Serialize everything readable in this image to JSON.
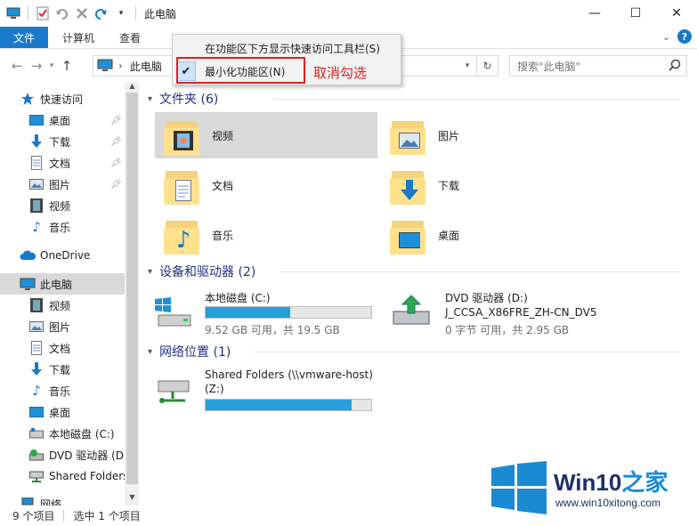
{
  "window": {
    "title": "此电脑",
    "minimize_glyph": "—",
    "maximize_glyph": "☐",
    "close_glyph": "✕"
  },
  "ribbon": {
    "tabs": [
      "文件",
      "计算机",
      "查看"
    ]
  },
  "menu": {
    "item1": "在功能区下方显示快速访问工具栏(S)",
    "item2": "最小化功能区(N)",
    "item2_checked": true
  },
  "annotation": {
    "text": "取消勾选",
    "color": "#e02020"
  },
  "address": {
    "crumb": "此电脑",
    "search_placeholder": "搜索\"此电脑\""
  },
  "nav": {
    "quick_access": "快速访问",
    "quick_items": [
      "桌面",
      "下载",
      "文档",
      "图片",
      "视频",
      "音乐"
    ],
    "onedrive": "OneDrive",
    "this_pc": "此电脑",
    "pc_items": [
      "视频",
      "图片",
      "文档",
      "下载",
      "音乐",
      "桌面",
      "本地磁盘 (C:)",
      "DVD 驱动器 (D:",
      "Shared Folders"
    ],
    "network": "网络"
  },
  "content": {
    "folders_header": "文件夹 (6)",
    "folders": [
      "视频",
      "图片",
      "文档",
      "下载",
      "音乐",
      "桌面"
    ],
    "devices_header": "设备和驱动器 (2)",
    "drive_c": {
      "name": "本地磁盘 (C:)",
      "info": "9.52 GB 可用，共 19.5 GB",
      "used_fraction": 0.51
    },
    "drive_d": {
      "name": "DVD 驱动器 (D:)",
      "label": "J_CCSA_X86FRE_ZH-CN_DV5",
      "info": "0 字节 可用，共 2.95 GB"
    },
    "network_header": "网络位置 (1)",
    "share": {
      "name": "Shared Folders (\\\\vmware-host)",
      "name2": "(Z:)",
      "used_fraction": 0.88
    }
  },
  "status": {
    "items": "9 个项目",
    "selected": "选中 1 个项目"
  },
  "watermark": {
    "brand": "Win10",
    "brand2": "之家",
    "url": "www.win10xitong.com"
  },
  "colors": {
    "accent": "#1979ca",
    "bar_fill": "#26a0da",
    "folder": "#ffe08d"
  }
}
